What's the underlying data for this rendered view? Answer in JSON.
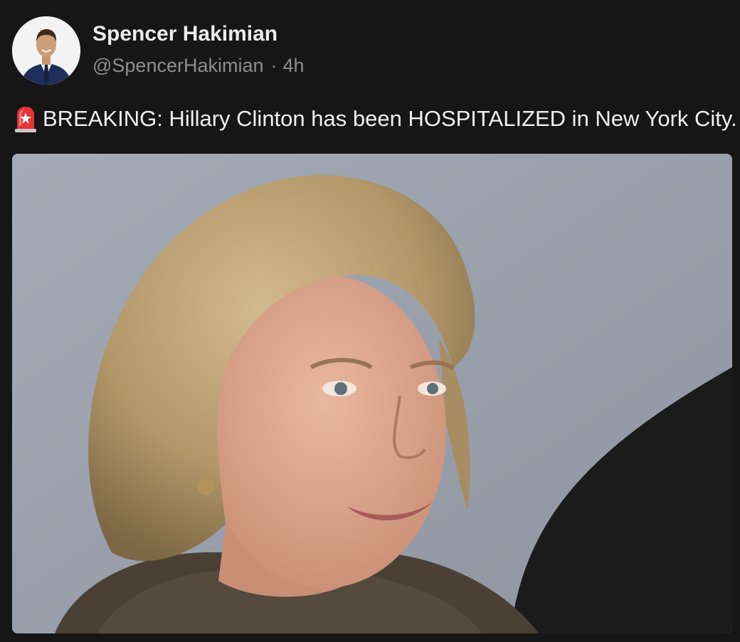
{
  "author": {
    "display_name": "Spencer Hakimian",
    "handle": "@SpencerHakimian",
    "separator": "·",
    "time_ago": "4h",
    "avatar_icon": "profile-avatar"
  },
  "post": {
    "emoji_icon": "police-siren-icon",
    "text": "BREAKING: Hillary Clinton has been HOSPITALIZED in New York City."
  },
  "media": {
    "kind": "photo",
    "background_color": "#9ba1ad"
  },
  "colors": {
    "background": "#161616",
    "name": "#ececec",
    "meta": "#8e8e8e",
    "text": "#f0f0f0"
  }
}
